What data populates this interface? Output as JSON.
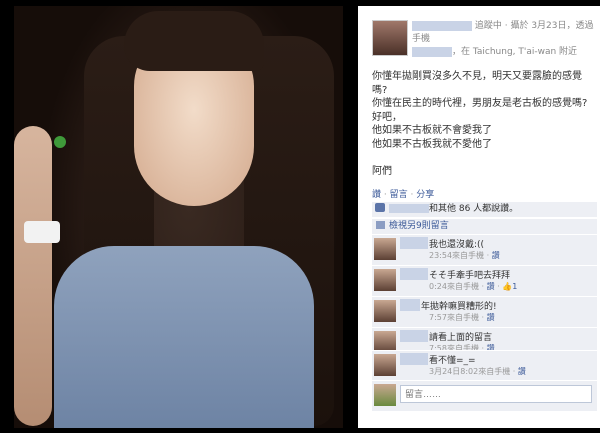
{
  "post": {
    "meta_line1": "追蹤中 · 攝於 3月23日，透過手機",
    "meta_line2": "，在 Taichung, T'ai-wan 附近",
    "text": "你懂年拋剛買沒多久不見，明天又要露臉的感覺嗎?\n你懂在民主的時代裡，男朋友是老古板的感覺嗎?\n好吧，\n他如果不古板就不會愛我了\n他如果不古板我就不愛他了\n\n阿們",
    "actions": [
      "讚",
      "留言",
      "分享"
    ]
  },
  "likes": {
    "text_prefix": "",
    "text": "和其他 86 人都說讚。"
  },
  "view_prev": "檢視另9則留言",
  "comments": [
    {
      "text": "我也還沒戴:((",
      "time": "23:54來自手機",
      "like": "讚",
      "count": ""
    },
    {
      "text": "そそ手牽手吧去拜拜",
      "time": "0:24來自手機",
      "like": "讚",
      "count": "1"
    },
    {
      "text": "年拋幹嘛買糟形的!",
      "time": "7:57來自手機",
      "like": "讚",
      "count": ""
    },
    {
      "text": "請看上面的留言",
      "time": "7:58來自手機",
      "like": "讚",
      "count": ""
    },
    {
      "text": "看不懂=_=",
      "time": "3月24日8:02來自手機",
      "like": "讚",
      "count": ""
    }
  ],
  "writer": {
    "placeholder": "留言……"
  }
}
